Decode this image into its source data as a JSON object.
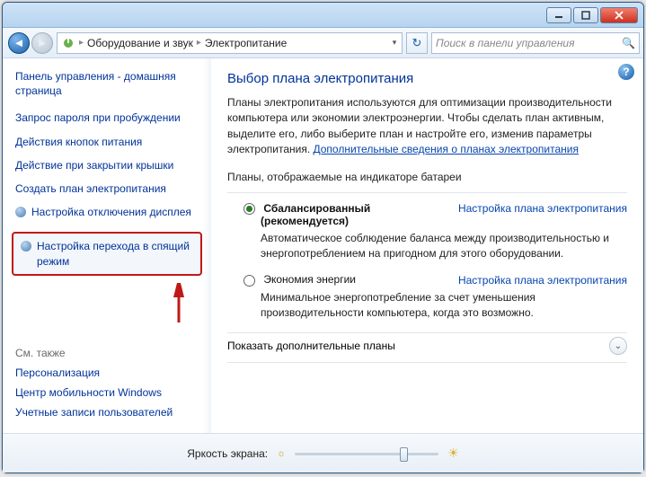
{
  "breadcrumb": {
    "seg1": "Оборудование и звук",
    "seg2": "Электропитание"
  },
  "search": {
    "placeholder": "Поиск в панели управления"
  },
  "sidebar": {
    "home": "Панель управления - домашняя страница",
    "links": [
      "Запрос пароля при пробуждении",
      "Действия кнопок питания",
      "Действие при закрытии крышки",
      "Создать план электропитания",
      "Настройка отключения дисплея",
      "Настройка перехода в спящий режим"
    ],
    "also_head": "См. также",
    "also": [
      "Персонализация",
      "Центр мобильности Windows",
      "Учетные записи пользователей"
    ]
  },
  "main": {
    "title": "Выбор плана электропитания",
    "desc_pre": "Планы электропитания используются для оптимизации производительности компьютера или экономии электроэнергии. Чтобы сделать план активным, выделите его, либо выберите план и настройте его, изменив параметры электропитания. ",
    "desc_link": "Дополнительные сведения о планах электропитания",
    "section": "Планы, отображаемые на индикаторе батареи",
    "plan1": {
      "name": "Сбалансированный",
      "rec": "(рекомендуется)",
      "link": "Настройка плана электропитания",
      "desc": "Автоматическое соблюдение баланса между производительностью и энергопотреблением на пригодном для этого оборудовании."
    },
    "plan2": {
      "name": "Экономия энергии",
      "link": "Настройка плана электропитания",
      "desc": "Минимальное энергопотребление за счет уменьшения производительности компьютера, когда это возможно."
    },
    "expander": "Показать дополнительные планы"
  },
  "footer": {
    "label": "Яркость экрана:",
    "slider_pct": 78
  }
}
